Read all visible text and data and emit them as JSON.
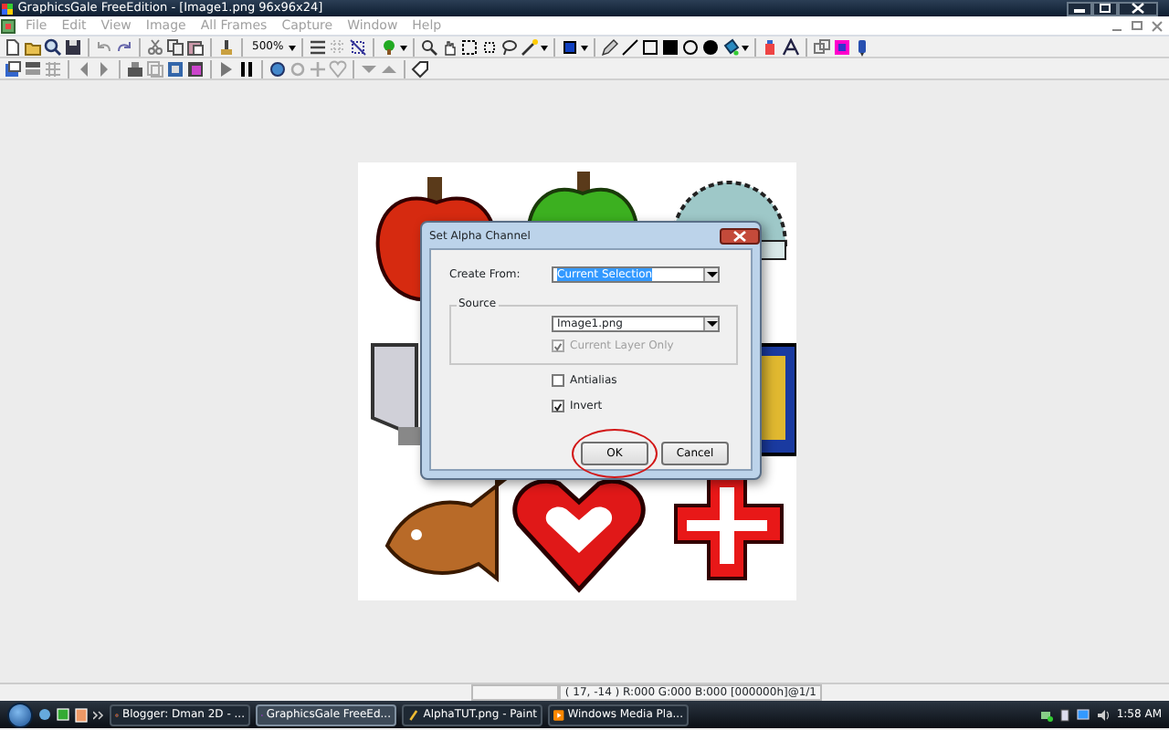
{
  "window": {
    "title": "GraphicsGale FreeEdition - [Image1.png 96x96x24]"
  },
  "menu": [
    {
      "label": "File",
      "disabled": true
    },
    {
      "label": "Edit",
      "disabled": true
    },
    {
      "label": "View",
      "disabled": true
    },
    {
      "label": "Image",
      "disabled": true
    },
    {
      "label": "All Frames",
      "disabled": true
    },
    {
      "label": "Capture",
      "disabled": true
    },
    {
      "label": "Window",
      "disabled": true
    },
    {
      "label": "Help",
      "disabled": true
    }
  ],
  "toolbar": {
    "zoom": "500%"
  },
  "dialog": {
    "title": "Set Alpha Channel",
    "create_from_label": "Create From:",
    "create_from_value": "Current Selection",
    "source_label": "Source",
    "source_value": "Image1.png",
    "checkboxes": [
      {
        "label": "Current Layer Only",
        "checked": true,
        "disabled": true
      },
      {
        "label": "Antialias",
        "checked": false,
        "disabled": false
      },
      {
        "label": "Invert",
        "checked": true,
        "disabled": false
      }
    ],
    "buttons": [
      {
        "label": "OK",
        "highlighted": true
      },
      {
        "label": "Cancel",
        "highlighted": false
      }
    ]
  },
  "status_bar": {
    "coordinates": "( 17, -14 ) R:000 G:000 B:000 [000000h]@1/1"
  },
  "taskbar": {
    "tasks": [
      {
        "label": "Blogger: Dman 2D - ...",
        "selected": false
      },
      {
        "label": "GraphicsGale FreeEd...",
        "selected": true
      },
      {
        "label": "AlphaTUT.png - Paint",
        "selected": false
      },
      {
        "label": "Windows Media Pla...",
        "selected": false
      }
    ],
    "clock": "1:58 AM"
  }
}
